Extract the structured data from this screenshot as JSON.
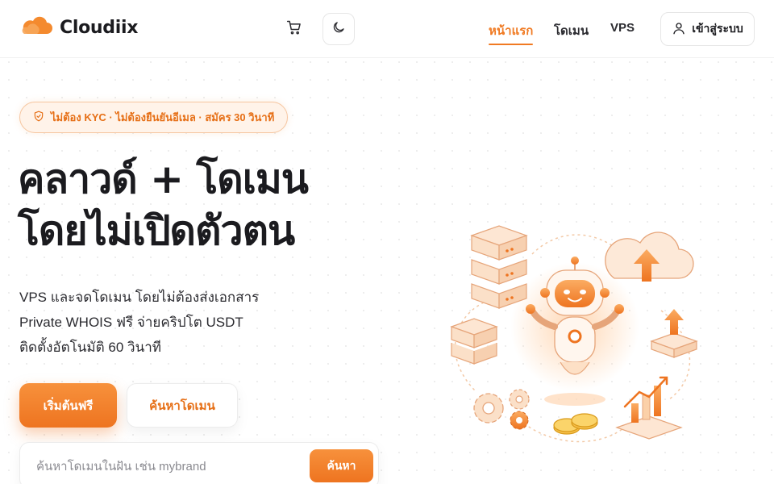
{
  "brand": {
    "name": "Cloudiix"
  },
  "nav": {
    "items": [
      {
        "label": "หน้าแรก",
        "active": true
      },
      {
        "label": "โดเมน",
        "active": false
      },
      {
        "label": "VPS",
        "active": false
      }
    ],
    "login_label": "เข้าสู่ระบบ"
  },
  "header_icons": [
    "cart-icon",
    "moon-icon"
  ],
  "hero": {
    "badge": "ไม่ต้อง KYC · ไม่ต้องยืนยันอีเมล · สมัคร 30 วินาที",
    "headline_line1": "คลาวด์ + โดเมน",
    "headline_line2": "โดยไม่เปิดตัวตน",
    "desc_line1": "VPS และจดโดเมน โดยไม่ต้องส่งเอกสาร",
    "desc_line2": "Private WHOIS ฟรี จ่ายคริปโต USDT",
    "desc_line3": "ติดตั้งอัตโนมัติ 60 วินาที",
    "cta_primary": "เริ่มต้นฟรี",
    "cta_secondary": "ค้นหาโดเมน"
  },
  "search": {
    "placeholder": "ค้นหาโดเมนในฝัน เช่น mybrand",
    "value": "",
    "button_label": "ค้นหา"
  },
  "colors": {
    "accent": "#f07a22",
    "accent_light": "#fff3e9",
    "text": "#1b1b1f"
  }
}
